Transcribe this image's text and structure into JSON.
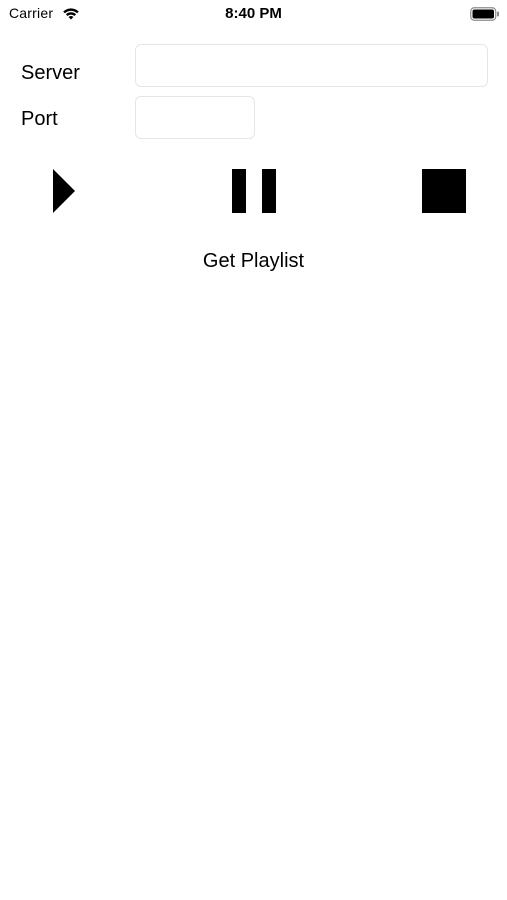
{
  "status_bar": {
    "carrier": "Carrier",
    "time": "8:40 PM",
    "icons": [
      "wifi-icon",
      "battery-icon"
    ]
  },
  "form": {
    "server_label": "Server",
    "server_value": "",
    "port_label": "Port",
    "port_value": ""
  },
  "controls": {
    "play_icon": "play-icon",
    "pause_icon": "pause-icon",
    "stop_icon": "stop-icon"
  },
  "actions": {
    "get_playlist_label": "Get Playlist"
  },
  "colors": {
    "background": "#ffffff",
    "foreground": "#000000",
    "field_border": "#e6e6e6"
  }
}
